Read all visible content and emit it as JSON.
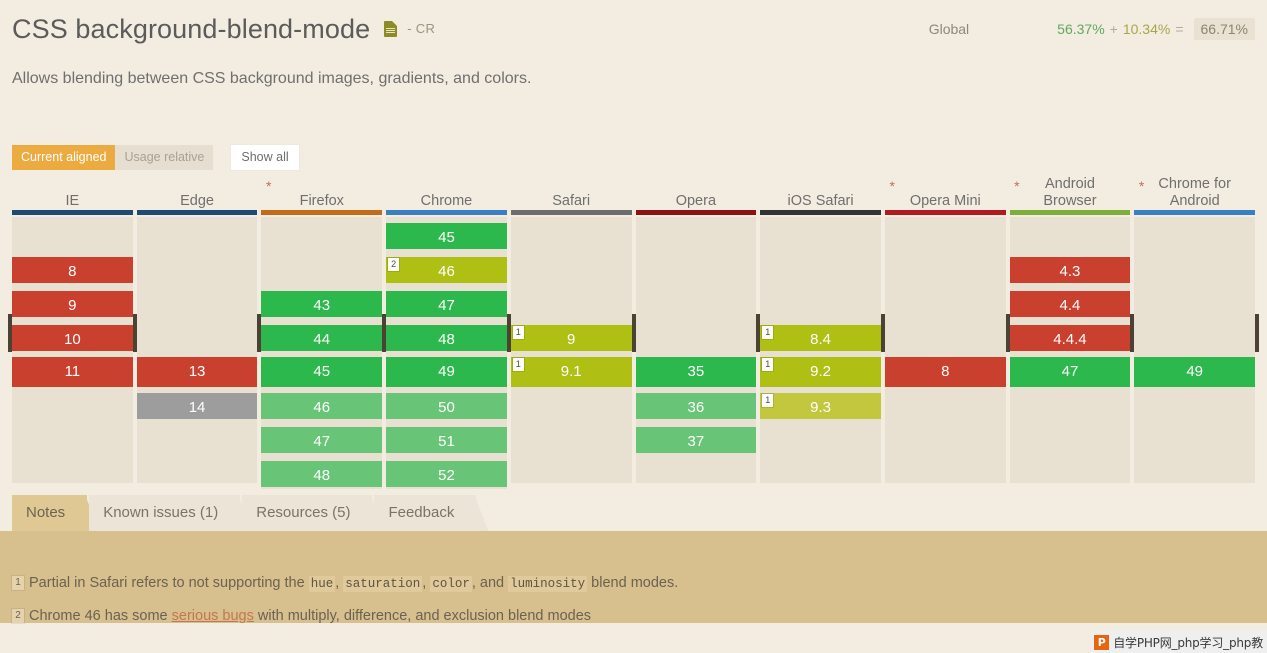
{
  "header": {
    "title": "CSS background-blend-mode",
    "spec_icon": "document-icon",
    "spec_status": "- CR",
    "description": "Allows blending between CSS background images, gradients, and colors.",
    "stats": {
      "region_label": "Global",
      "full_support": "56.37%",
      "plus": "+",
      "partial_support": "10.34%",
      "equals": "=",
      "total": "66.71%"
    }
  },
  "controls": {
    "current_aligned": "Current aligned",
    "usage_relative": "Usage relative",
    "show_all": "Show all"
  },
  "colors": {
    "supported": "#2db84d",
    "supported_future": "#68c577",
    "unsupported": "#c9402f",
    "partial": "#b0bf14",
    "partial_future": "#c2c73d",
    "unknown": "#9d9d9d",
    "accent": "#ecab41",
    "current_row_border": "#4b4233",
    "page_background": "#f3ece0",
    "notes_background": "#d8bf8e"
  },
  "browsers": [
    {
      "name": "IE",
      "bar_color": "#1f4b73",
      "prefix_star": false,
      "versions": [
        {
          "label": "8",
          "status": "n",
          "row": 1
        },
        {
          "label": "9",
          "status": "n",
          "row": 2
        },
        {
          "label": "10",
          "status": "n",
          "row": 3
        },
        {
          "label": "11",
          "status": "n",
          "row": 4,
          "current": true
        }
      ]
    },
    {
      "name": "Edge",
      "bar_color": "#1f4b73",
      "prefix_star": true,
      "versions": [
        {
          "label": "13",
          "status": "n",
          "row": 4,
          "current": true
        },
        {
          "label": "14",
          "status": "u",
          "row": 5
        }
      ]
    },
    {
      "name": "Firefox",
      "bar_color": "#bf6d19",
      "prefix_star": false,
      "versions": [
        {
          "label": "43",
          "status": "y",
          "row": 2
        },
        {
          "label": "44",
          "status": "y",
          "row": 3
        },
        {
          "label": "45",
          "status": "y",
          "row": 4,
          "current": true
        },
        {
          "label": "46",
          "status": "yf",
          "row": 5
        },
        {
          "label": "47",
          "status": "yf",
          "row": 6
        },
        {
          "label": "48",
          "status": "yf",
          "row": 7
        }
      ]
    },
    {
      "name": "Chrome",
      "bar_color": "#3a7fc1",
      "prefix_star": false,
      "versions": [
        {
          "label": "45",
          "status": "y",
          "row": 0
        },
        {
          "label": "46",
          "status": "a",
          "row": 1,
          "badge": "2"
        },
        {
          "label": "47",
          "status": "y",
          "row": 2
        },
        {
          "label": "48",
          "status": "y",
          "row": 3
        },
        {
          "label": "49",
          "status": "y",
          "row": 4,
          "current": true
        },
        {
          "label": "50",
          "status": "yf",
          "row": 5
        },
        {
          "label": "51",
          "status": "yf",
          "row": 6
        },
        {
          "label": "52",
          "status": "yf",
          "row": 7
        }
      ]
    },
    {
      "name": "Safari",
      "bar_color": "#6d6d6d",
      "prefix_star": false,
      "versions": [
        {
          "label": "9",
          "status": "a",
          "row": 3,
          "badge": "1"
        },
        {
          "label": "9.1",
          "status": "a",
          "row": 4,
          "badge": "1",
          "current": true
        }
      ]
    },
    {
      "name": "Opera",
      "bar_color": "#8a1414",
      "prefix_star": false,
      "versions": [
        {
          "label": "35",
          "status": "y",
          "row": 4,
          "current": true
        },
        {
          "label": "36",
          "status": "yf",
          "row": 5
        },
        {
          "label": "37",
          "status": "yf",
          "row": 6
        }
      ]
    },
    {
      "name": "iOS Safari",
      "bar_color": "#333333",
      "prefix_star": true,
      "versions": [
        {
          "label": "8.4",
          "status": "a",
          "row": 3,
          "badge": "1"
        },
        {
          "label": "9.2",
          "status": "a",
          "row": 4,
          "badge": "1",
          "current": true
        },
        {
          "label": "9.3",
          "status": "af",
          "row": 5,
          "badge": "1"
        }
      ]
    },
    {
      "name": "Opera Mini",
      "bar_color": "#ae1c22",
      "prefix_star": true,
      "versions": [
        {
          "label": "8",
          "status": "n",
          "row": 4,
          "current": true
        }
      ]
    },
    {
      "name": "Android Browser",
      "bar_color": "#7ead3c",
      "prefix_star": true,
      "versions": [
        {
          "label": "4.3",
          "status": "n",
          "row": 1
        },
        {
          "label": "4.4",
          "status": "n",
          "row": 2
        },
        {
          "label": "4.4.4",
          "status": "n",
          "row": 3
        },
        {
          "label": "47",
          "status": "y",
          "row": 4,
          "current": true
        }
      ]
    },
    {
      "name": "Chrome for Android",
      "bar_color": "#3a7fc1",
      "prefix_star": false,
      "versions": [
        {
          "label": "49",
          "status": "y",
          "row": 4,
          "current": true
        }
      ]
    }
  ],
  "tabs": [
    {
      "label": "Notes",
      "active": true
    },
    {
      "label": "Known issues (1)",
      "active": false
    },
    {
      "label": "Resources (5)",
      "active": false
    },
    {
      "label": "Feedback",
      "active": false
    }
  ],
  "notes": {
    "note1": {
      "num": "1",
      "part1": "Partial in Safari refers to not supporting the ",
      "code1": "hue",
      "sep1": ", ",
      "code2": "saturation",
      "sep2": ", ",
      "code3": "color",
      "sep3": ", and ",
      "code4": "luminosity",
      "part2": " blend modes."
    },
    "note2": {
      "num": "2",
      "part1": "Chrome 46 has some ",
      "link": "serious bugs",
      "part2": " with multiply, difference, and exclusion blend modes"
    }
  },
  "watermark": {
    "logo": "P",
    "text": "自学PHP网_php学习_php教"
  }
}
